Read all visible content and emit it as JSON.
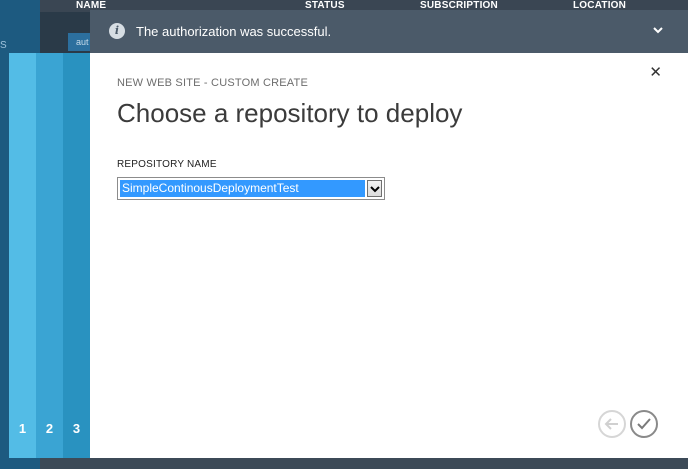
{
  "background": {
    "columns": [
      "NAME",
      "STATUS",
      "SUBSCRIPTION",
      "LOCATION"
    ],
    "left_label": "S",
    "row_text": "aut"
  },
  "notification": {
    "text": "The authorization was successful.",
    "icon": "info-icon",
    "expand_icon": "chevron-down-icon"
  },
  "wizard": {
    "steps": [
      "1",
      "2",
      "3"
    ],
    "subtitle": "NEW WEB SITE - CUSTOM CREATE",
    "title": "Choose a repository to deploy",
    "close_icon": "close-icon",
    "repository_field": {
      "label": "REPOSITORY NAME",
      "selected_value": "SimpleContinousDeploymentTest"
    },
    "back_icon": "arrow-left-icon",
    "finish_icon": "checkmark-icon"
  },
  "colors": {
    "step1": "#53bce6",
    "step2": "#3aa4d3",
    "step3": "#2992c0",
    "selection": "#3399ff",
    "notification_bg": "#4b5a69"
  }
}
